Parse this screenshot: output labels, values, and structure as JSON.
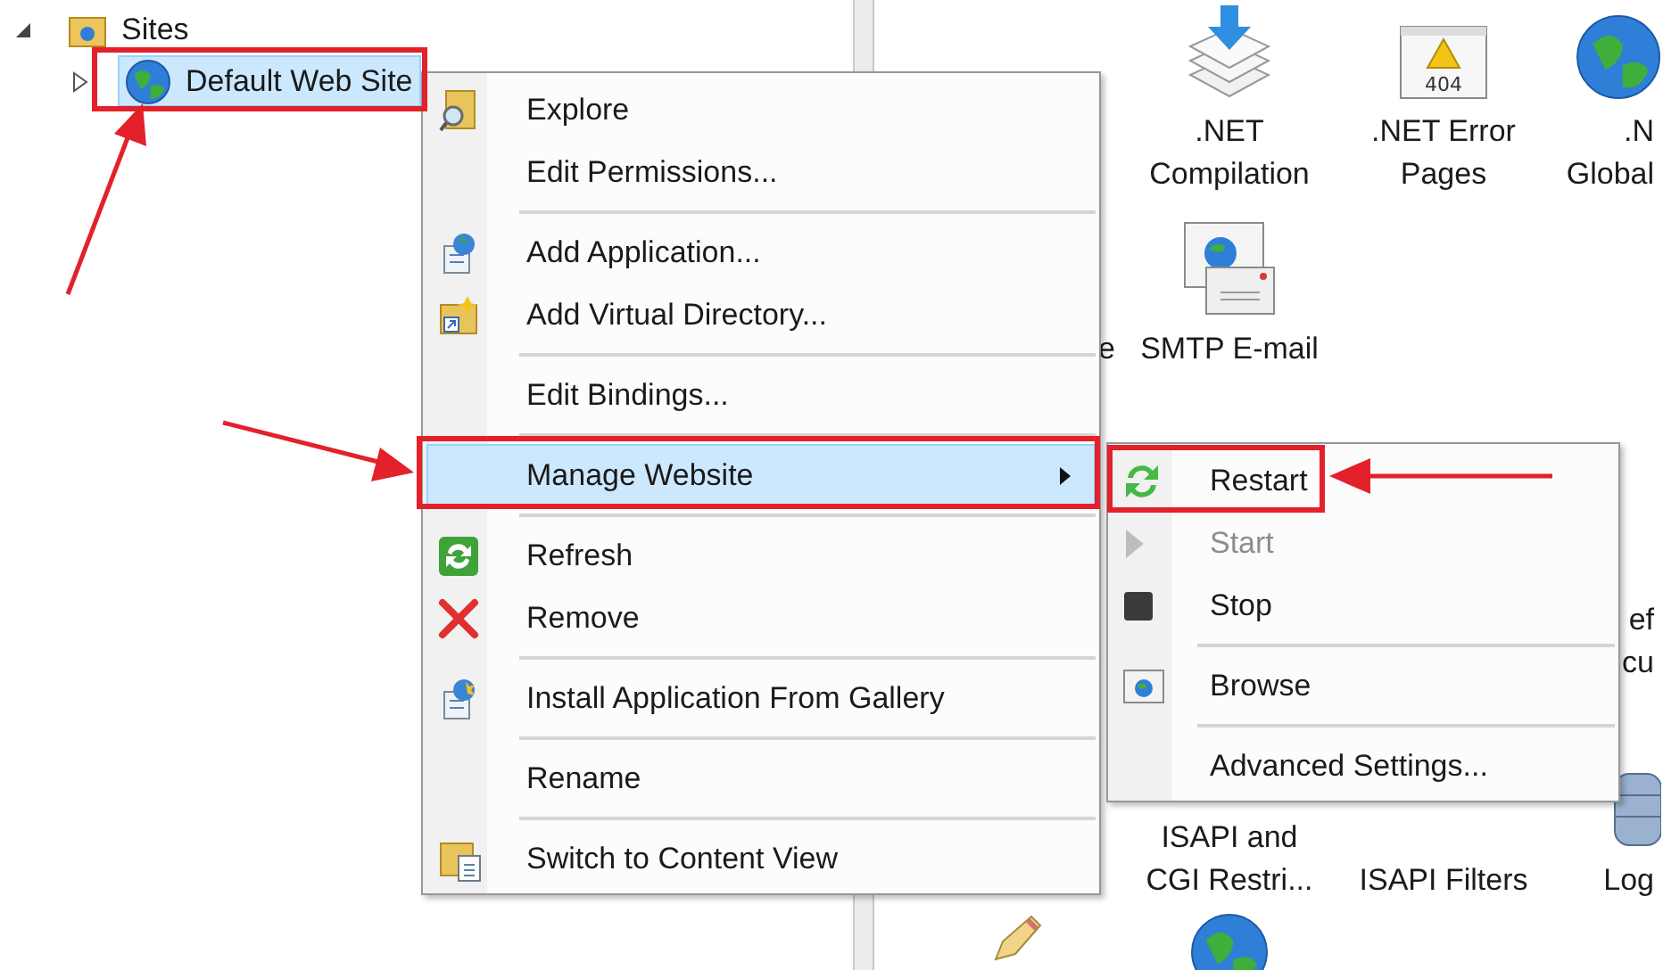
{
  "tree": [
    {
      "label": "Sites",
      "expanded": true,
      "selected": false,
      "children": [
        {
          "label": "Default Web Site",
          "expanded": false,
          "selected": true
        }
      ]
    }
  ],
  "features": [
    {
      "lines": [
        ".NET",
        "Compilation"
      ]
    },
    {
      "lines": [
        ".NET Error",
        "Pages"
      ],
      "badge": "404"
    },
    {
      "lines": [
        ".N",
        "Global"
      ]
    },
    {
      "lines": [
        "e"
      ]
    },
    {
      "lines": [
        "SMTP E-mail"
      ]
    },
    {
      "lines": [
        "ef",
        "cu"
      ]
    },
    {
      "lines": [
        "ISAPI and",
        "CGI Restri..."
      ]
    },
    {
      "lines": [
        "ISAPI Filters"
      ]
    },
    {
      "lines": [
        "Log"
      ]
    }
  ],
  "context_menu": {
    "items": [
      {
        "kind": "item",
        "label": "Explore",
        "selected": false,
        "has_submenu": false
      },
      {
        "kind": "item",
        "label": "Edit Permissions...",
        "selected": false,
        "has_submenu": false
      },
      {
        "kind": "separator"
      },
      {
        "kind": "item",
        "label": "Add Application...",
        "selected": false,
        "has_submenu": false
      },
      {
        "kind": "item",
        "label": "Add Virtual Directory...",
        "selected": false,
        "has_submenu": false
      },
      {
        "kind": "separator"
      },
      {
        "kind": "item",
        "label": "Edit Bindings...",
        "selected": false,
        "has_submenu": false
      },
      {
        "kind": "separator"
      },
      {
        "kind": "item",
        "label": "Manage Website",
        "selected": true,
        "has_submenu": true
      },
      {
        "kind": "separator"
      },
      {
        "kind": "item",
        "label": "Refresh",
        "selected": false,
        "has_submenu": false
      },
      {
        "kind": "item",
        "label": "Remove",
        "selected": false,
        "has_submenu": false
      },
      {
        "kind": "separator"
      },
      {
        "kind": "item",
        "label": "Install Application From Gallery",
        "selected": false,
        "has_submenu": false
      },
      {
        "kind": "separator"
      },
      {
        "kind": "item",
        "label": "Rename",
        "selected": false,
        "has_submenu": false
      },
      {
        "kind": "separator"
      },
      {
        "kind": "item",
        "label": "Switch to Content View",
        "selected": false,
        "has_submenu": false
      }
    ]
  },
  "submenu": {
    "items": [
      {
        "kind": "item",
        "label": "Restart",
        "disabled": false
      },
      {
        "kind": "item",
        "label": "Start",
        "disabled": true
      },
      {
        "kind": "item",
        "label": "Stop",
        "disabled": false
      },
      {
        "kind": "separator"
      },
      {
        "kind": "item",
        "label": "Browse",
        "disabled": false
      },
      {
        "kind": "separator"
      },
      {
        "kind": "item",
        "label": "Advanced Settings...",
        "disabled": false
      }
    ]
  }
}
